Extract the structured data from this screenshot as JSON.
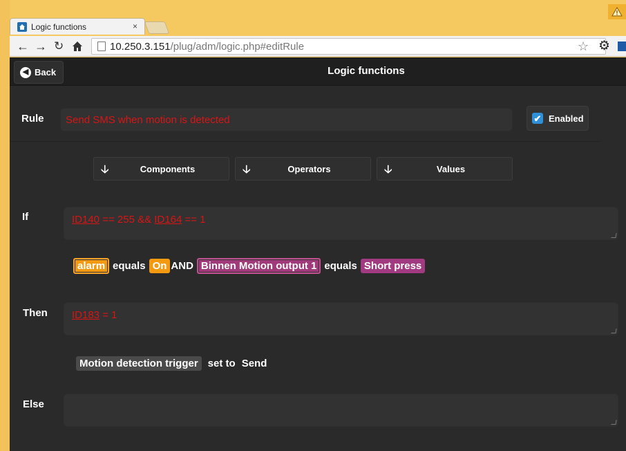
{
  "browser": {
    "tab_title": "Logic functions",
    "tab_close": "×",
    "url_host": "10.250.3.151",
    "url_path": "/plug/adm/logic.php#editRule"
  },
  "appbar": {
    "back_label": "Back",
    "title": "Logic functions"
  },
  "rule": {
    "label": "Rule",
    "value": "Send SMS when motion is detected",
    "enabled_label": "Enabled",
    "enabled": true
  },
  "menus": [
    {
      "label": "Components"
    },
    {
      "label": "Operators"
    },
    {
      "label": "Values"
    }
  ],
  "if_section": {
    "label": "If",
    "code_parts": [
      "ID140",
      " == 255 && ",
      "ID164",
      " == 1"
    ],
    "tokens": {
      "t1": "alarm",
      "t2": "equals",
      "t3": "On",
      "t4": "AND",
      "t5": "Binnen Motion output 1",
      "t6": "equals",
      "t7": "Short press"
    }
  },
  "then_section": {
    "label": "Then",
    "code_parts": [
      "ID183",
      " = 1"
    ],
    "tokens": {
      "t1": "Motion detection trigger",
      "t2": "set to",
      "t3": "Send"
    }
  },
  "else_section": {
    "label": "Else",
    "code": ""
  },
  "colors": {
    "background": "#2a2a2a",
    "code_text": "#d81515",
    "component_orange": "#f39a10",
    "component_purple": "#a13a80",
    "checkbox": "#2f8fd8"
  }
}
